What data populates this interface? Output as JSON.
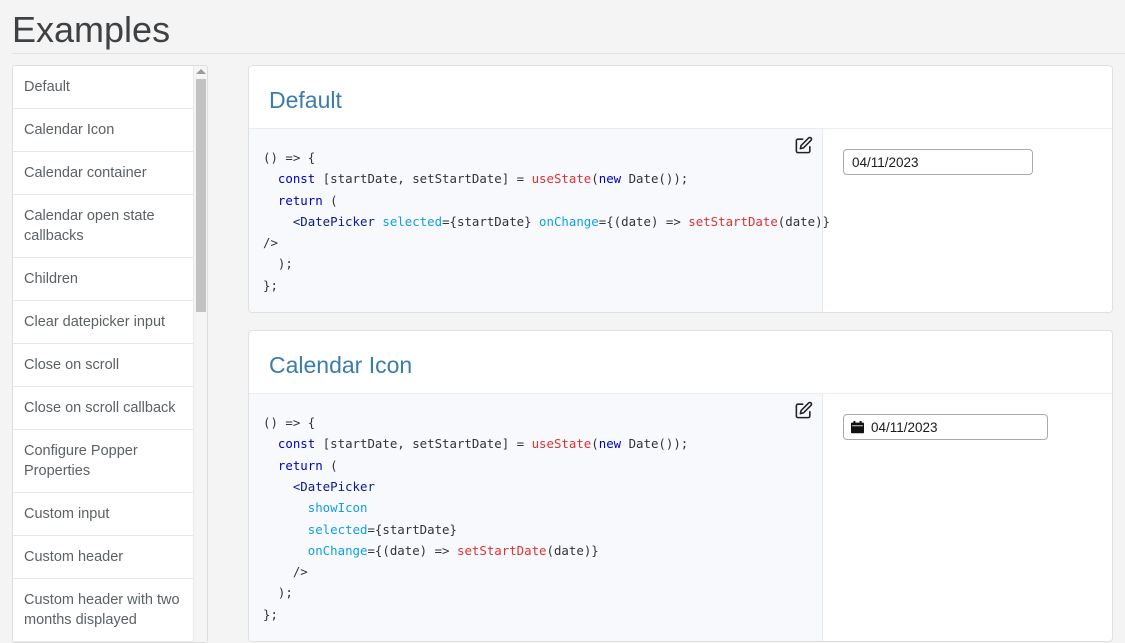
{
  "page": {
    "title": "Examples"
  },
  "sidebar": {
    "name": "examples-list",
    "scroll": {
      "arrow_icon": "triangle-up-icon"
    },
    "items": [
      {
        "label": "Default"
      },
      {
        "label": "Calendar Icon"
      },
      {
        "label": "Calendar container"
      },
      {
        "label": "Calendar open state callbacks"
      },
      {
        "label": "Children"
      },
      {
        "label": "Clear datepicker input"
      },
      {
        "label": "Close on scroll"
      },
      {
        "label": "Close on scroll callback"
      },
      {
        "label": "Configure Popper Properties"
      },
      {
        "label": "Custom input"
      },
      {
        "label": "Custom header"
      },
      {
        "label": "Custom header with two months displayed"
      }
    ]
  },
  "examples": [
    {
      "title": "Default",
      "edit_icon": "edit-pencil-square-icon",
      "code_lines": [
        [
          {
            "t": "() => {",
            "c": "plain"
          }
        ],
        [
          {
            "t": "  ",
            "c": "plain"
          },
          {
            "t": "const",
            "c": "kw"
          },
          {
            "t": " [startDate, setStartDate] = ",
            "c": "plain"
          },
          {
            "t": "useState",
            "c": "fn"
          },
          {
            "t": "(",
            "c": "plain"
          },
          {
            "t": "new",
            "c": "kw"
          },
          {
            "t": " Date());",
            "c": "plain"
          }
        ],
        [
          {
            "t": "  ",
            "c": "plain"
          },
          {
            "t": "return",
            "c": "kw"
          },
          {
            "t": " (",
            "c": "plain"
          }
        ],
        [
          {
            "t": "    ",
            "c": "plain"
          },
          {
            "t": "<DatePicker",
            "c": "tag"
          },
          {
            "t": " ",
            "c": "plain"
          },
          {
            "t": "selected",
            "c": "attr"
          },
          {
            "t": "={startDate} ",
            "c": "plain"
          },
          {
            "t": "onChange",
            "c": "attr"
          },
          {
            "t": "={(date) => ",
            "c": "plain"
          },
          {
            "t": "setStartDate",
            "c": "fn"
          },
          {
            "t": "(date)}",
            "c": "plain"
          }
        ],
        [
          {
            "t": "/>",
            "c": "plain"
          }
        ],
        [
          {
            "t": "  );",
            "c": "plain"
          }
        ],
        [
          {
            "t": "};",
            "c": "plain"
          }
        ]
      ],
      "demo": {
        "type": "date-input",
        "value": "04/11/2023",
        "show_icon": false,
        "icon": null
      }
    },
    {
      "title": "Calendar Icon",
      "edit_icon": "edit-pencil-square-icon",
      "code_lines": [
        [
          {
            "t": "() => {",
            "c": "plain"
          }
        ],
        [
          {
            "t": "  ",
            "c": "plain"
          },
          {
            "t": "const",
            "c": "kw"
          },
          {
            "t": " [startDate, setStartDate] = ",
            "c": "plain"
          },
          {
            "t": "useState",
            "c": "fn"
          },
          {
            "t": "(",
            "c": "plain"
          },
          {
            "t": "new",
            "c": "kw"
          },
          {
            "t": " Date());",
            "c": "plain"
          }
        ],
        [
          {
            "t": "  ",
            "c": "plain"
          },
          {
            "t": "return",
            "c": "kw"
          },
          {
            "t": " (",
            "c": "plain"
          }
        ],
        [
          {
            "t": "    ",
            "c": "plain"
          },
          {
            "t": "<DatePicker",
            "c": "tag"
          }
        ],
        [
          {
            "t": "      ",
            "c": "plain"
          },
          {
            "t": "showIcon",
            "c": "attr"
          }
        ],
        [
          {
            "t": "      ",
            "c": "plain"
          },
          {
            "t": "selected",
            "c": "attr"
          },
          {
            "t": "={startDate}",
            "c": "plain"
          }
        ],
        [
          {
            "t": "      ",
            "c": "plain"
          },
          {
            "t": "onChange",
            "c": "attr"
          },
          {
            "t": "={(date) => ",
            "c": "plain"
          },
          {
            "t": "setStartDate",
            "c": "fn"
          },
          {
            "t": "(date)}",
            "c": "plain"
          }
        ],
        [
          {
            "t": "    />",
            "c": "plain"
          }
        ],
        [
          {
            "t": "  );",
            "c": "plain"
          }
        ],
        [
          {
            "t": "};",
            "c": "plain"
          }
        ]
      ],
      "demo": {
        "type": "date-input",
        "value": "04/11/2023",
        "show_icon": true,
        "icon": "calendar-icon"
      }
    }
  ],
  "colors": {
    "page_background": "#f4f4f4",
    "card_background": "#ffffff",
    "heading_blue": "#3b7cac",
    "title_gray": "#3f4245",
    "code_background": "#f7f9fc",
    "keyword": "#0000c0",
    "tag": "#0a1a8c",
    "attribute": "#0fa0e0",
    "function": "#e03131",
    "code_text": "#333333",
    "border": "#e0e0e0",
    "scrollbar_thumb": "#c2c2c2"
  }
}
